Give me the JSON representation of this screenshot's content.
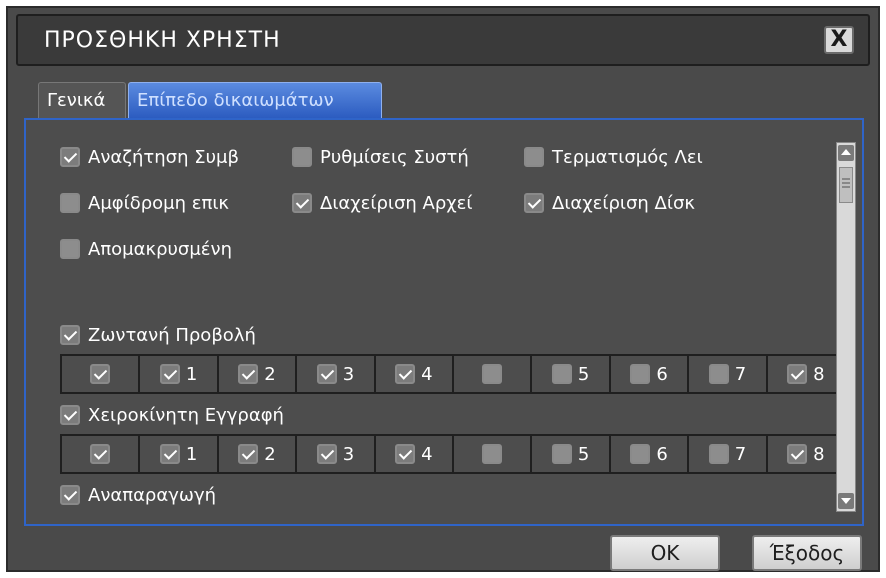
{
  "dialog": {
    "title": "ΠΡΟΣΘΗΚΗ ΧΡΗΣΤΗ",
    "close_label": "X"
  },
  "tabs": [
    {
      "label": "Γενικά",
      "active": false
    },
    {
      "label": "Επίπεδο δικαιωμάτων",
      "active": true
    }
  ],
  "permissions": [
    {
      "label": "Αναζήτηση Συμβ",
      "checked": true
    },
    {
      "label": "Ρυθμίσεις Συστή",
      "checked": false
    },
    {
      "label": "Τερματισμός Λει",
      "checked": false
    },
    {
      "label": "Αμφίδρομη επικ",
      "checked": false
    },
    {
      "label": "Διαχείριση Αρχεί",
      "checked": true
    },
    {
      "label": "Διαχείριση Δίσκ",
      "checked": true
    },
    {
      "label": "Απομακρυσμένη",
      "checked": false
    }
  ],
  "live_view": {
    "label": "Ζωντανή Προβολή",
    "checked": true,
    "channels": [
      {
        "num": "",
        "checked": true
      },
      {
        "num": "1",
        "checked": true
      },
      {
        "num": "2",
        "checked": true
      },
      {
        "num": "3",
        "checked": true
      },
      {
        "num": "4",
        "checked": true
      },
      {
        "num": "",
        "checked": false
      },
      {
        "num": "5",
        "checked": false
      },
      {
        "num": "6",
        "checked": false
      },
      {
        "num": "7",
        "checked": false
      },
      {
        "num": "8",
        "checked": true
      }
    ]
  },
  "manual_record": {
    "label": "Χειροκίνητη Εγγραφή",
    "checked": true,
    "channels": [
      {
        "num": "",
        "checked": true
      },
      {
        "num": "1",
        "checked": true
      },
      {
        "num": "2",
        "checked": true
      },
      {
        "num": "3",
        "checked": true
      },
      {
        "num": "4",
        "checked": true
      },
      {
        "num": "",
        "checked": false
      },
      {
        "num": "5",
        "checked": false
      },
      {
        "num": "6",
        "checked": false
      },
      {
        "num": "7",
        "checked": false
      },
      {
        "num": "8",
        "checked": true
      }
    ]
  },
  "playback": {
    "label": "Αναπαραγωγή",
    "checked": true
  },
  "buttons": {
    "ok_label": "OK",
    "exit_label": "Έξοδος"
  }
}
